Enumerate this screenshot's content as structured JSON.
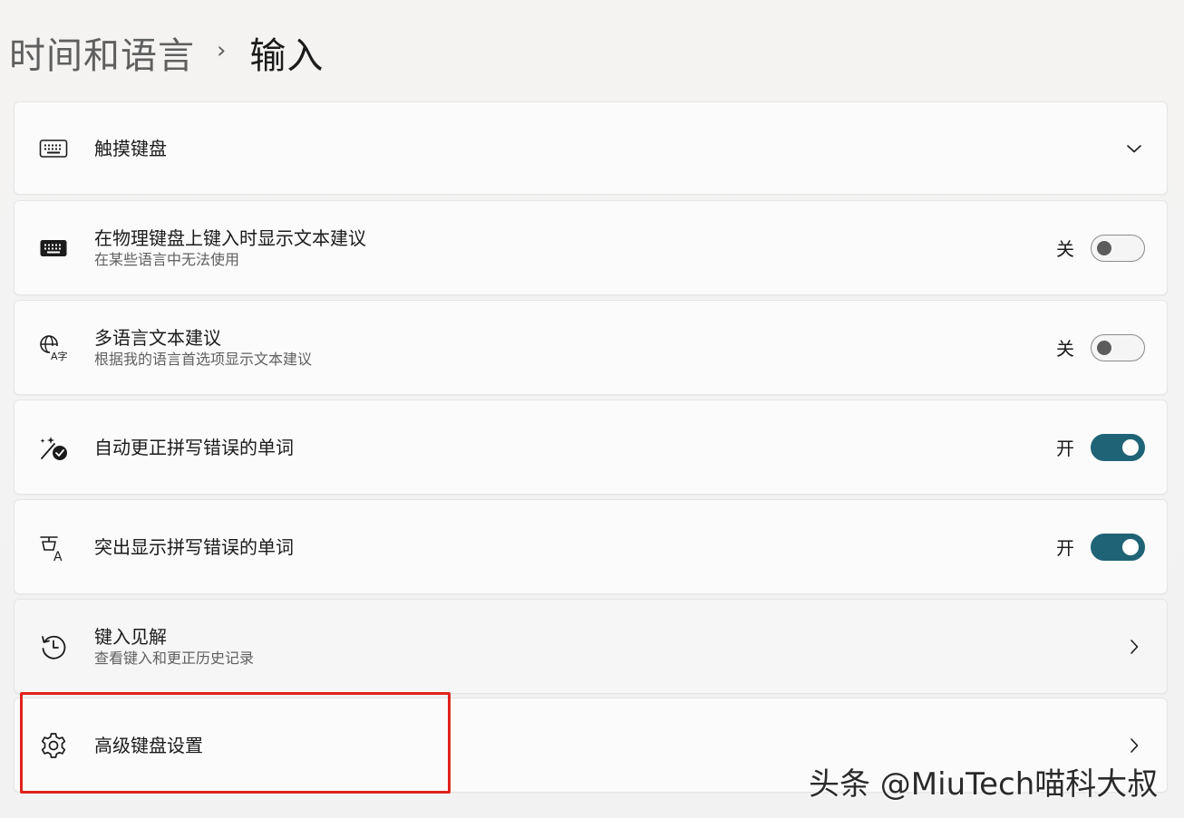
{
  "header": {
    "parent": "时间和语言",
    "separator": "›",
    "current": "输入"
  },
  "items": [
    {
      "icon": "keyboard-outline-icon",
      "title": "触摸键盘",
      "control": "chevron-down"
    },
    {
      "icon": "keyboard-filled-icon",
      "title": "在物理键盘上键入时显示文本建议",
      "desc": "在某些语言中无法使用",
      "state_label": "关",
      "state": "off"
    },
    {
      "icon": "translate-icon",
      "title": "多语言文本建议",
      "desc": "根据我的语言首选项显示文本建议",
      "state_label": "关",
      "state": "off"
    },
    {
      "icon": "autocorrect-icon",
      "title": "自动更正拼写错误的单词",
      "state_label": "开",
      "state": "on"
    },
    {
      "icon": "spellcheck-icon",
      "title": "突出显示拼写错误的单词",
      "state_label": "开",
      "state": "on"
    },
    {
      "icon": "history-icon",
      "title": "键入见解",
      "desc": "查看键入和更正历史记录",
      "control": "chevron-right"
    },
    {
      "icon": "gear-icon",
      "title": "高级键盘设置",
      "control": "chevron-right"
    }
  ],
  "colors": {
    "toggle_on": "#1f6376",
    "highlight_box": "#e0231b"
  },
  "watermark": "头条 @MiuTech喵科大叔"
}
